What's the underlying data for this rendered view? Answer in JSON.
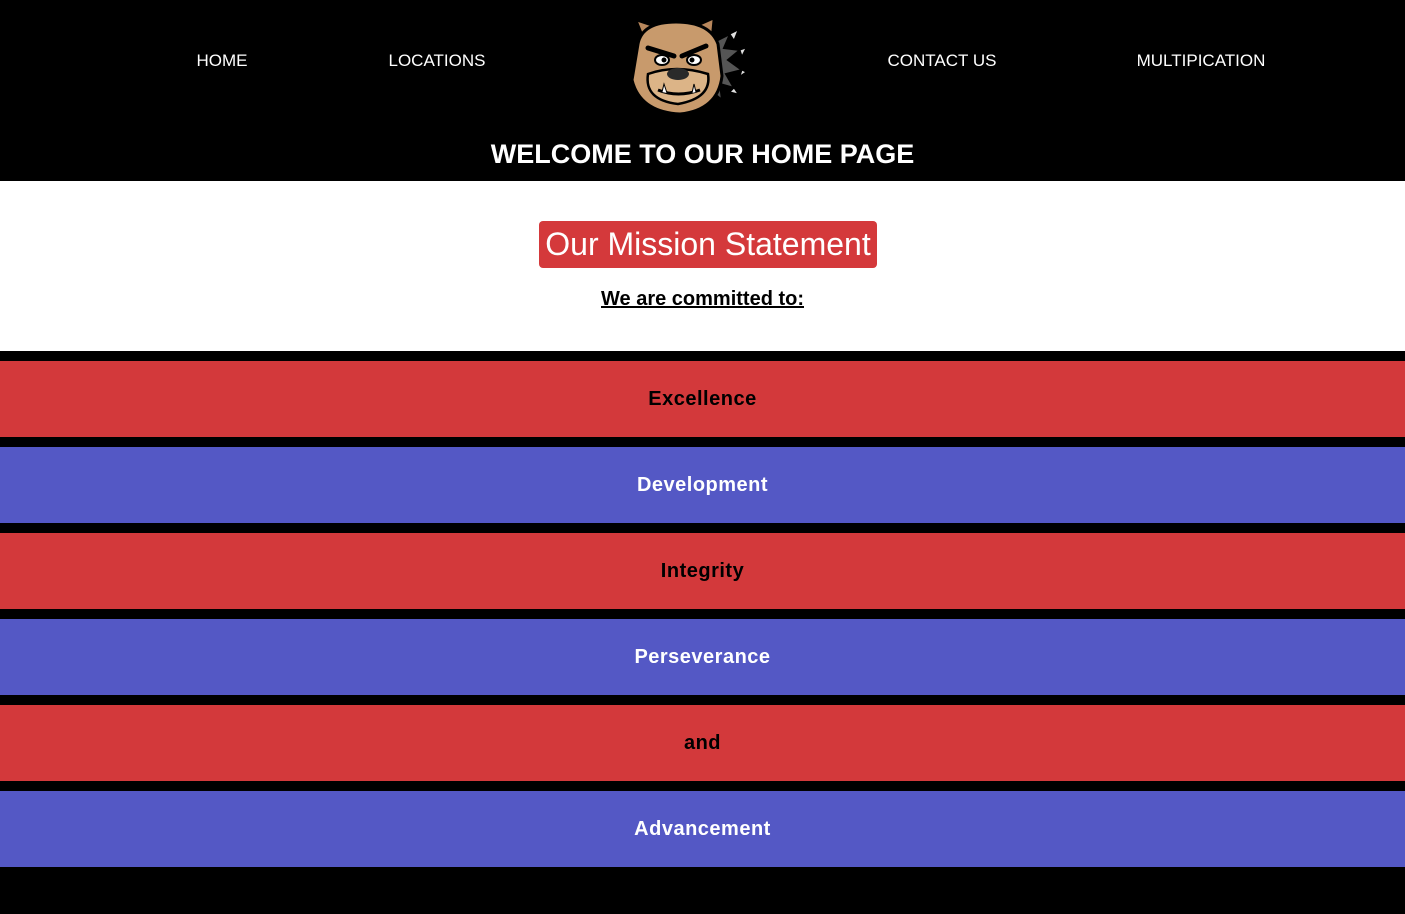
{
  "nav": {
    "home": "HOME",
    "locations": "LOCATIONS",
    "contact": "CONTACT US",
    "multiplication": "MULTIPICATION"
  },
  "logo": {
    "icon": "bulldog-mascot-icon"
  },
  "header": {
    "welcome": "WELCOME TO OUR HOME PAGE"
  },
  "mission": {
    "title": "Our Mission Statement",
    "subtitle": "We are committed to:",
    "items": [
      "Excellence",
      "Development",
      "Integrity",
      "Perseverance",
      "and",
      "Advancement"
    ]
  },
  "colors": {
    "background": "#000000",
    "red": "#d3393b",
    "blue": "#5458c5",
    "white": "#ffffff"
  }
}
